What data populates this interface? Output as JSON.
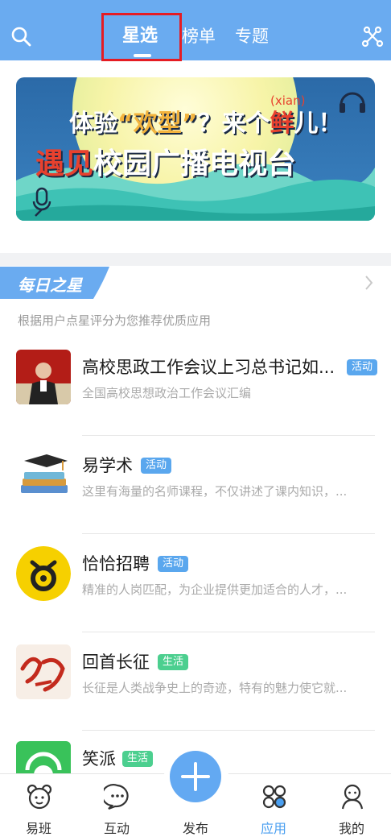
{
  "header": {
    "tabs": [
      {
        "label": "星选",
        "active": true
      },
      {
        "label": "榜单",
        "active": false
      },
      {
        "label": "专题",
        "active": false
      }
    ],
    "search_icon": "search-icon",
    "filter_icon": "share-nodes-icon"
  },
  "banner": {
    "line1_a": "体验",
    "line1_b": "“欢型”",
    "line1_c": "？来个",
    "line1_d": "鲜",
    "line1_e": "儿！",
    "pinyin": "(xian)",
    "line2_a": "遇见",
    "line2_b": "校园广播电视台"
  },
  "daily": {
    "tag": "每日之星",
    "subtitle": "根据用户点星评分为您推荐优质应用"
  },
  "apps": [
    {
      "title": "高校思政工作会议上习总书记如...",
      "badge": "活动",
      "badge_color": "#5aa7ee",
      "desc": "全国高校思想政治工作会议汇编"
    },
    {
      "title": "易学术",
      "badge": "活动",
      "badge_color": "#5aa7ee",
      "desc": "这里有海量的名师课程，不仅讲述了课内知识，..."
    },
    {
      "title": "恰恰招聘",
      "badge": "活动",
      "badge_color": "#5aa7ee",
      "desc": "精准的人岗匹配，为企业提供更加适合的人才，..."
    },
    {
      "title": "回首长征",
      "badge": "生活",
      "badge_color": "#4ccf8f",
      "desc": "长征是人类战争史上的奇迹，特有的魅力使它就..."
    },
    {
      "title": "笑派",
      "badge": "生活",
      "badge_color": "#4ccf8f",
      "desc": ""
    }
  ],
  "tabbar": [
    {
      "label": "易班",
      "icon": "bear-icon",
      "active": false
    },
    {
      "label": "互动",
      "icon": "chat-bubble-icon",
      "active": false
    },
    {
      "label": "发布",
      "icon": "plus-icon",
      "active": false
    },
    {
      "label": "应用",
      "icon": "apps-grid-icon",
      "active": true
    },
    {
      "label": "我的",
      "icon": "person-icon",
      "active": false
    }
  ],
  "colors": {
    "accent": "#6aabf0",
    "active_tab": "#4a9ff0",
    "fab": "#63a9f2"
  }
}
